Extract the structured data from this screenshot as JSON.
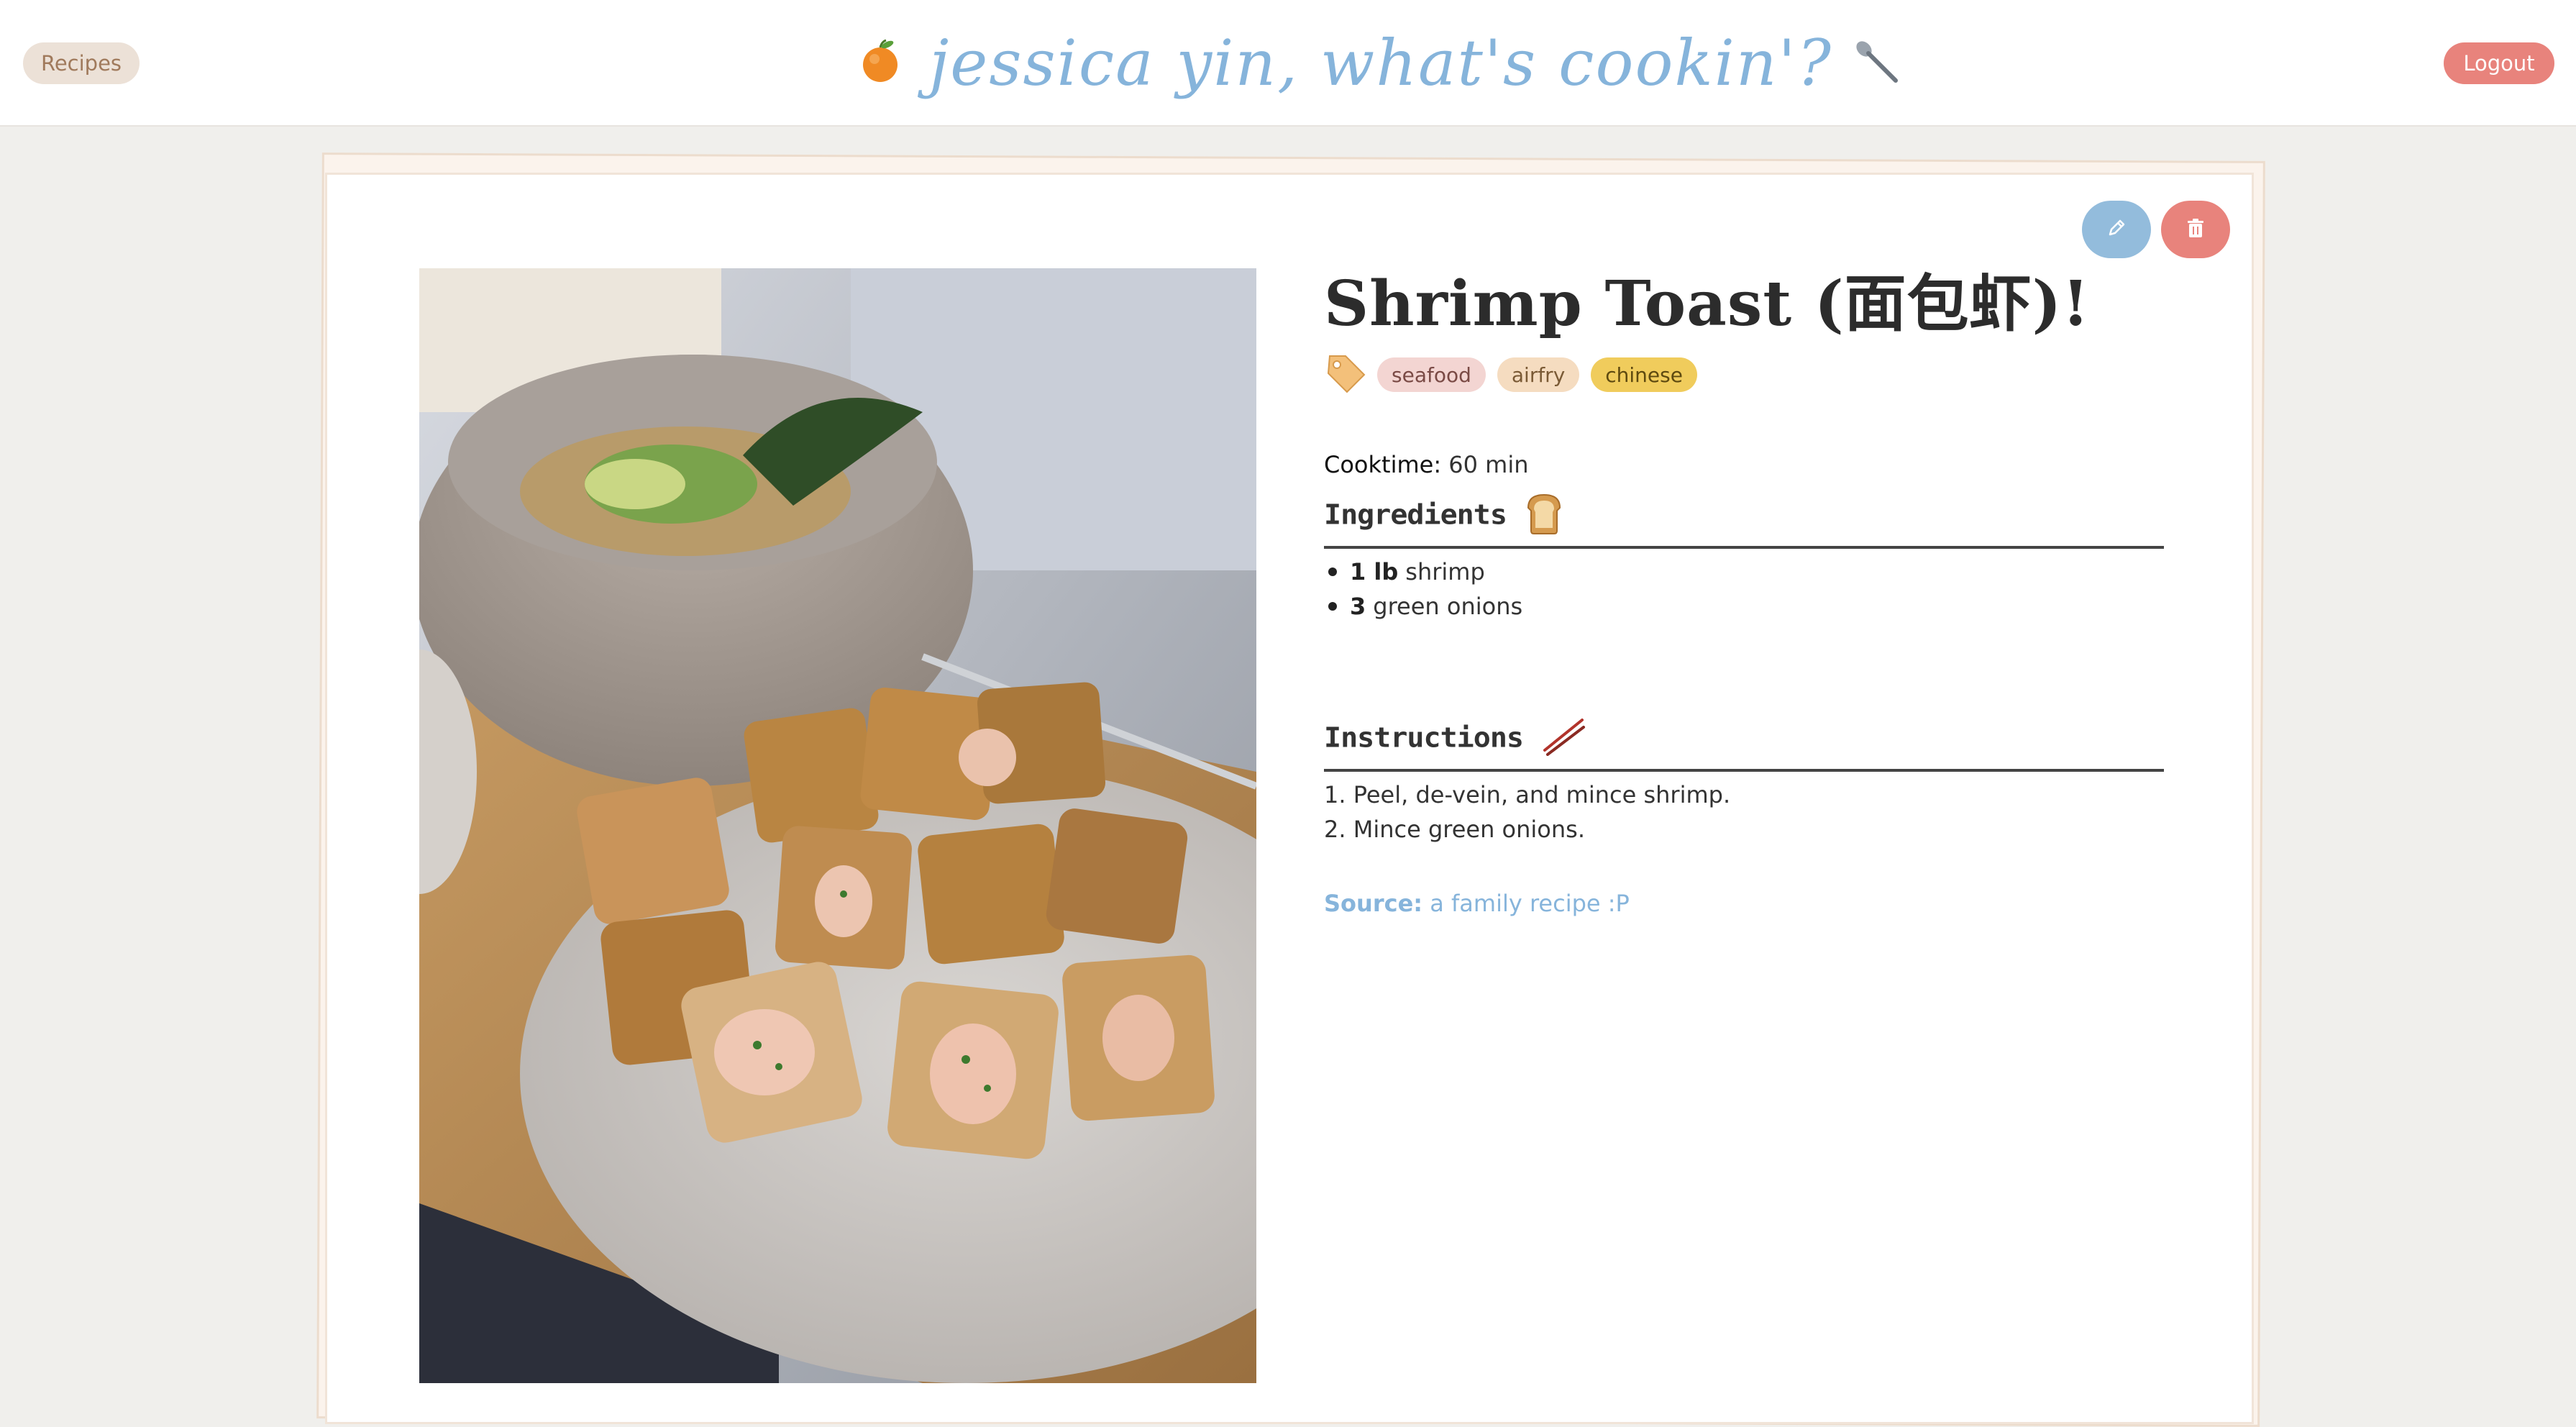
{
  "header": {
    "recipes_button": "Recipes",
    "logout_button": "Logout",
    "site_title": "jessica yin, what's cookin'?",
    "left_icon": "orange-icon",
    "right_icon": "spoon-icon"
  },
  "recipe": {
    "title": "Shrimp Toast (面包虾)!",
    "tag_icon": "price-tag-icon",
    "tags": [
      {
        "label": "seafood",
        "bg": "#f3d5d2",
        "color": "#7a4a45"
      },
      {
        "label": "airfry",
        "bg": "#f5dcc0",
        "color": "#7a5a35"
      },
      {
        "label": "chinese",
        "bg": "#f0cc5c",
        "color": "#5e4a10"
      }
    ],
    "cooktime_label": "Cooktime:",
    "cooktime_value": "60 min",
    "ingredients_heading": "Ingredients",
    "ingredients_icon": "bread-icon",
    "ingredients": [
      {
        "qty": "1 lb",
        "name": "shrimp"
      },
      {
        "qty": "3",
        "name": "green onions"
      }
    ],
    "instructions_heading": "Instructions",
    "instructions_icon": "chopsticks-icon",
    "instructions": [
      "1. Peel, de-vein, and mince shrimp.",
      "2. Mince green onions."
    ],
    "source_label": "Source:",
    "source_value": "a family recipe :P",
    "photo": "shrimp-toast-photo"
  },
  "actions": {
    "edit_icon": "pencil-icon",
    "delete_icon": "trash-icon"
  },
  "colors": {
    "accent_blue": "#86b4db",
    "accent_red": "#e8837c",
    "background": "#f0efec"
  }
}
